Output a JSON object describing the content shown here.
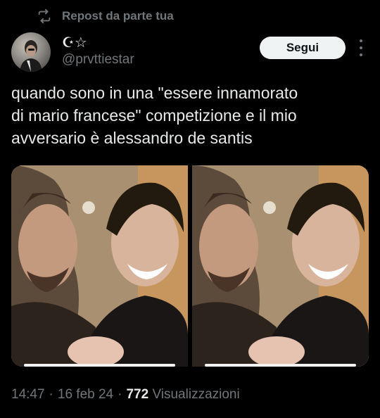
{
  "repost": {
    "label": "Repost da parte tua",
    "icon": "repost-icon"
  },
  "author": {
    "display_name": "☪︎☆",
    "handle": "@prvttiestar",
    "avatar_icon": "avatar"
  },
  "follow_button": {
    "label": "Segui"
  },
  "more_icon": "more-options-icon",
  "tweet": {
    "lines": [
      "quando sono in una \"essere innamorato",
      "di mario francese\" competizione e il mio",
      "avversario è alessandro de santis"
    ]
  },
  "media": {
    "photos": [
      {
        "name": "photo-1"
      },
      {
        "name": "photo-2"
      }
    ]
  },
  "meta": {
    "time": "14:47",
    "separator": "·",
    "date": "16 feb 24",
    "views_count": "772",
    "views_label": "Visualizzazioni"
  },
  "colors": {
    "background": "#000000",
    "text_primary": "#e7e9ea",
    "text_secondary": "#71767b",
    "button_bg": "#eff3f4",
    "button_text": "#0f1419"
  }
}
